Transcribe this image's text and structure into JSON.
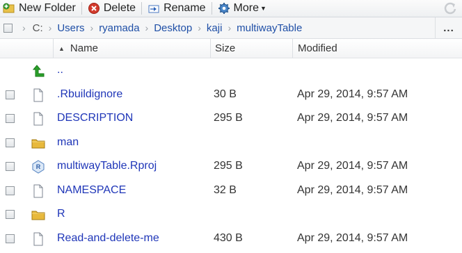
{
  "toolbar": {
    "new_folder": "New Folder",
    "delete": "Delete",
    "rename": "Rename",
    "more": "More"
  },
  "breadcrumb": [
    "C:",
    "Users",
    "ryamada",
    "Desktop",
    "kaji",
    "multiwayTable"
  ],
  "more_label": "...",
  "columns": {
    "name": "Name",
    "size": "Size",
    "modified": "Modified"
  },
  "files": [
    {
      "name": "..",
      "size": "",
      "modified": "",
      "icon": "up-arrow-icon",
      "checkbox": false
    },
    {
      "name": ".Rbuildignore",
      "size": "30 B",
      "modified": "Apr 29, 2014, 9:57 AM",
      "icon": "file-icon",
      "checkbox": true
    },
    {
      "name": "DESCRIPTION",
      "size": "295 B",
      "modified": "Apr 29, 2014, 9:57 AM",
      "icon": "file-icon",
      "checkbox": true
    },
    {
      "name": "man",
      "size": "",
      "modified": "",
      "icon": "folder-icon",
      "checkbox": true
    },
    {
      "name": "multiwayTable.Rproj",
      "size": "295 B",
      "modified": "Apr 29, 2014, 9:57 AM",
      "icon": "rproj-icon",
      "checkbox": true
    },
    {
      "name": "NAMESPACE",
      "size": "32 B",
      "modified": "Apr 29, 2014, 9:57 AM",
      "icon": "file-icon",
      "checkbox": true
    },
    {
      "name": "R",
      "size": "",
      "modified": "",
      "icon": "folder-icon",
      "checkbox": true
    },
    {
      "name": "Read-and-delete-me",
      "size": "430 B",
      "modified": "Apr 29, 2014, 9:57 AM",
      "icon": "file-icon",
      "checkbox": true
    }
  ]
}
